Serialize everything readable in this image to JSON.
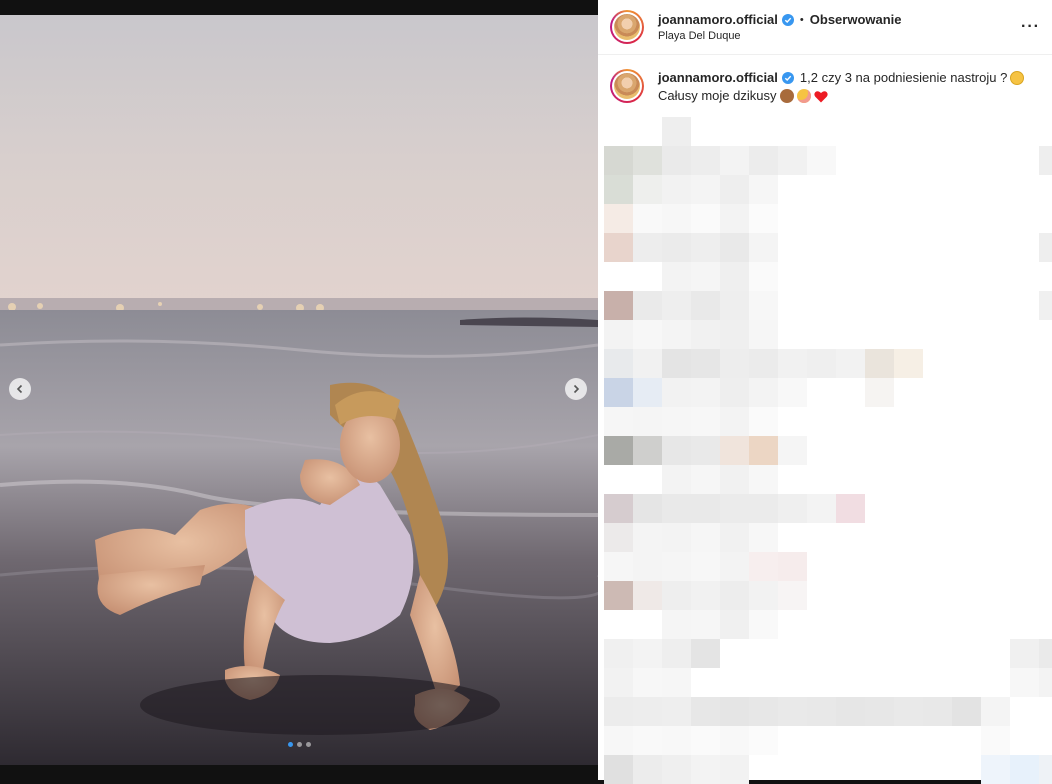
{
  "post": {
    "username": "joannamoro.official",
    "follow_label": "Obserwowanie",
    "separator": "•",
    "location": "Playa Del Duque",
    "more_icon": "more-horizontal-icon",
    "verified_icon": "verified-badge-icon"
  },
  "caption": {
    "username": "joannamoro.official",
    "line1": "1,2 czy 3 na podniesienie nastroju ?",
    "line2": "Całusy moje dzikusy",
    "emojis_line1": [
      "winking-face-tongue"
    ],
    "emojis_line2": [
      "see-no-evil-monkey",
      "smiling-face-with-hearts",
      "red-heart"
    ]
  },
  "carousel": {
    "slide_count": 3,
    "active_slide": 1,
    "prev_icon": "chevron-left-icon",
    "next_icon": "chevron-right-icon"
  },
  "colors": {
    "accent_blue": "#3897f0",
    "text": "#262626",
    "heart_red": "#ed1c24"
  }
}
